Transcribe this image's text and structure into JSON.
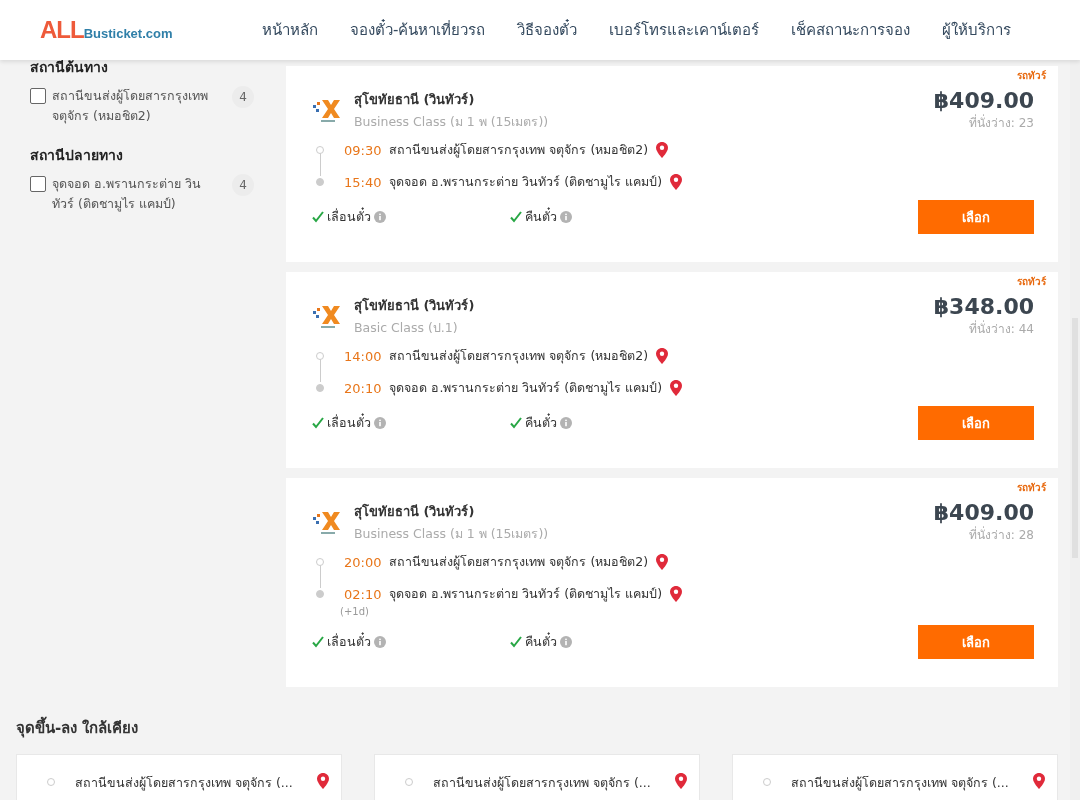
{
  "header": {
    "logo_main": "ALL",
    "logo_sub": "Busticket.com",
    "nav": [
      {
        "label": "หน้าหลัก"
      },
      {
        "label": "จองตั๋ว-ค้นหาเที่ยวรถ"
      },
      {
        "label": "วิธีจองตั๋ว"
      },
      {
        "label": "เบอร์โทรและเคาน์เตอร์"
      },
      {
        "label": "เช็คสถานะการจอง"
      },
      {
        "label": "ผู้ให้บริการ"
      }
    ]
  },
  "filters": [
    {
      "title": "สถานีต้นทาง",
      "options": [
        {
          "label": "สถานีขนส่งผู้โดยสารกรุงเทพ จตุจักร (หมอชิต2)",
          "count": "4",
          "checked": false
        }
      ]
    },
    {
      "title": "สถานีปลายทาง",
      "options": [
        {
          "label": "จุดจอด อ.พรานกระต่าย วินทัวร์ (ติดชามูไร แคมป์)",
          "count": "4",
          "checked": false
        }
      ]
    }
  ],
  "trips": [
    {
      "tag": "รถทัวร์",
      "operator": "สุโขทัยธานี (วินทัวร์)",
      "class": "Business Class (ม 1 พ (15เมตร))",
      "price": "฿409.00",
      "seats": "ที่นั่งว่าง: 23",
      "departure": {
        "time": "09:30",
        "place": "สถานีขนส่งผู้โดยสารกรุงเทพ จตุจักร (หมอชิต2)"
      },
      "arrival": {
        "time": "15:40",
        "place": "จุดจอด อ.พรานกระต่าย วินทัวร์ (ติดชามูไร แคมป์)"
      },
      "features": [
        {
          "label": "เลื่อนตั๋ว",
          "available": true
        },
        {
          "label": "คืนตั๋ว",
          "available": true
        }
      ],
      "button": "เลือก"
    },
    {
      "tag": "รถทัวร์",
      "operator": "สุโขทัยธานี (วินทัวร์)",
      "class": "Basic Class (ป.1)",
      "price": "฿348.00",
      "seats": "ที่นั่งว่าง: 44",
      "departure": {
        "time": "14:00",
        "place": "สถานีขนส่งผู้โดยสารกรุงเทพ จตุจักร (หมอชิต2)"
      },
      "arrival": {
        "time": "20:10",
        "place": "จุดจอด อ.พรานกระต่าย วินทัวร์ (ติดชามูไร แคมป์)"
      },
      "features": [
        {
          "label": "เลื่อนตั๋ว",
          "available": true
        },
        {
          "label": "คืนตั๋ว",
          "available": true
        }
      ],
      "button": "เลือก"
    },
    {
      "tag": "รถทัวร์",
      "operator": "สุโขทัยธานี (วินทัวร์)",
      "class": "Business Class (ม 1 พ (15เมตร))",
      "price": "฿409.00",
      "seats": "ที่นั่งว่าง: 28",
      "departure": {
        "time": "20:00",
        "place": "สถานีขนส่งผู้โดยสารกรุงเทพ จตุจักร (หมอชิต2)"
      },
      "arrival": {
        "time": "02:10",
        "day_offset": "(+1d)",
        "place": "จุดจอด อ.พรานกระต่าย วินทัวร์ (ติดชามูไร แคมป์)"
      },
      "features": [
        {
          "label": "เลื่อนตั๋ว",
          "available": true
        },
        {
          "label": "คืนตั๋ว",
          "available": true
        }
      ],
      "button": "เลือก"
    }
  ],
  "nearby": {
    "title": "จุดขึ้น-ลง ใกล้เคียง",
    "items": [
      {
        "place": "สถานีขนส่งผู้โดยสารกรุงเทพ จตุจักร (..."
      },
      {
        "place": "สถานีขนส่งผู้โดยสารกรุงเทพ จตุจักร (..."
      },
      {
        "place": "สถานีขนส่งผู้โดยสารกรุงเทพ จตุจักร (..."
      }
    ]
  }
}
